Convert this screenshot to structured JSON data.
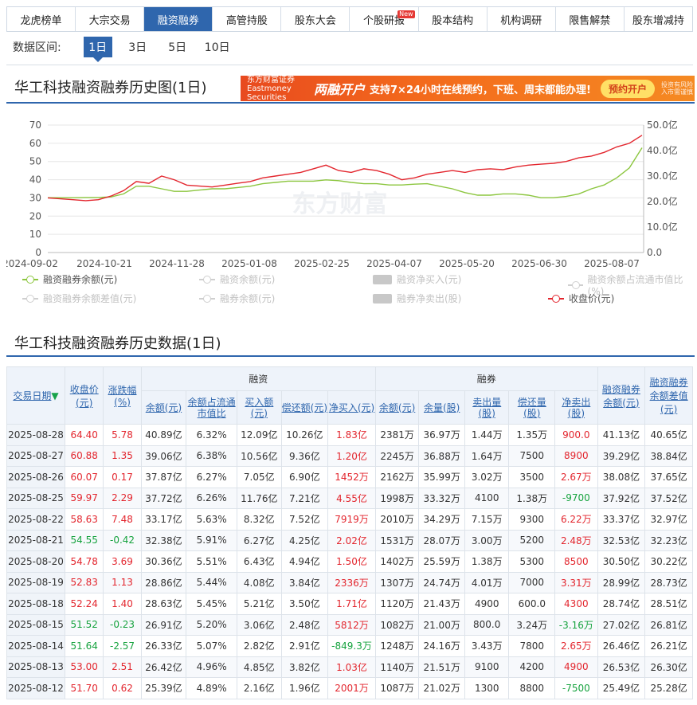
{
  "nav": {
    "tabs": [
      "龙虎榜单",
      "大宗交易",
      "融资融券",
      "高管持股",
      "股东大会",
      "个股研报",
      "股本结构",
      "机构调研",
      "限售解禁",
      "股东增减持"
    ],
    "active_index": 2,
    "badge_text": "New",
    "badge_index": 5
  },
  "range": {
    "label": "数据区间:",
    "options": [
      "1日",
      "3日",
      "5日",
      "10日"
    ],
    "active_index": 0
  },
  "chart_section_title": "华工科技融资融券历史图(1日)",
  "banner": {
    "logo": "东方财富证券 Eastmoney Securities",
    "headline": "两融开户",
    "text": "支持7×24小时在线预约，下班、周末都能办理!",
    "button": "预约开户",
    "tail": "投资有风险 入市需谨慎"
  },
  "watermark": "东方财富",
  "chart_data": {
    "type": "line",
    "x_ticks": [
      "2024-09-02",
      "2024-10-21",
      "2024-11-28",
      "2025-01-08",
      "2025-02-25",
      "2025-04-07",
      "2025-05-20",
      "2025-06-30",
      "2025-08-07"
    ],
    "y_left_ticks": [
      "70",
      "60",
      "50",
      "40",
      "30",
      "20",
      "10",
      "0"
    ],
    "y_left_range": [
      0,
      70
    ],
    "y_right_ticks": [
      "50.0亿",
      "40.0亿",
      "30.0亿",
      "20.0亿",
      "10.0亿",
      "0.0"
    ],
    "y_right_range": [
      0,
      50
    ],
    "grid": true,
    "series": [
      {
        "name": "收盘价(元)",
        "axis": "left",
        "color": "#e3262e",
        "values": [
          30,
          29.5,
          29,
          28.5,
          29,
          31,
          34,
          39,
          38,
          42,
          40,
          37,
          36.5,
          36,
          37,
          38,
          39,
          41,
          42,
          43,
          44,
          46,
          48,
          45,
          44,
          46,
          45,
          43,
          40,
          41,
          43,
          44,
          45,
          44,
          45.5,
          46,
          45.5,
          47,
          48,
          48.5,
          49,
          50,
          52,
          53,
          55,
          58,
          60,
          64.4
        ]
      },
      {
        "name": "融资融券余额(元)",
        "axis": "right",
        "color": "#8cc63f",
        "values": [
          21.5,
          21.5,
          21.5,
          21.6,
          21.6,
          21.8,
          23,
          26,
          26,
          25,
          24,
          24,
          24.5,
          25,
          25,
          25.5,
          26,
          27,
          27.5,
          28,
          28,
          28,
          28.5,
          28.2,
          27.5,
          27,
          27,
          26.5,
          26.5,
          26.8,
          27,
          26,
          25,
          23.5,
          22.5,
          22.5,
          23,
          23,
          22.5,
          21.5,
          21.5,
          22,
          23,
          25,
          26.5,
          29.3,
          33.2,
          41.1
        ]
      }
    ]
  },
  "legend": [
    {
      "label": "融资融券余额(元)",
      "kind": "line",
      "color": "#8cc63f",
      "active": true
    },
    {
      "label": "融资余额(元)",
      "kind": "line",
      "color": "#cfcfcf",
      "active": false
    },
    {
      "label": "融资净买入(元)",
      "kind": "bar",
      "color": "#c8c8c8",
      "active": false
    },
    {
      "label": "融资余额占流通市值比(%)",
      "kind": "line",
      "color": "#cfcfcf",
      "active": false
    },
    {
      "label": "融资融券余额差值(元)",
      "kind": "line",
      "color": "#cfcfcf",
      "active": false
    },
    {
      "label": "融券余额(元)",
      "kind": "line",
      "color": "#cfcfcf",
      "active": false
    },
    {
      "label": "融券净卖出(股)",
      "kind": "bar",
      "color": "#c8c8c8",
      "active": false
    },
    {
      "label": "收盘价(元)",
      "kind": "line",
      "color": "#e3262e",
      "active": true
    }
  ],
  "table_section_title": "华工科技融资融券历史数据(1日)",
  "table": {
    "group_headers": {
      "margin_buy": "融资",
      "short_sell": "融券"
    },
    "headers": {
      "date": "交易日期",
      "close": "收盘价(元)",
      "change": "涨跌幅(%)",
      "fin_balance": "余额(元)",
      "fin_ratio": "余额占流通市值比",
      "fin_buy": "买入额(元)",
      "fin_repay": "偿还额(元)",
      "fin_net": "净买入(元)",
      "sec_balance": "余额(元)",
      "sec_volume": "余量(股)",
      "sec_sell": "卖出量(股)",
      "sec_repay": "偿还量(股)",
      "sec_net": "净卖出(股)",
      "total": "融资融券余额(元)",
      "diff": "融资融券余额差值(元)"
    },
    "rows": [
      [
        "2025-08-28",
        "64.40",
        "5.78",
        "40.89亿",
        "6.32%",
        "12.09亿",
        "10.26亿",
        "1.83亿",
        "2381万",
        "36.97万",
        "1.44万",
        "1.35万",
        "900.0",
        "41.13亿",
        "40.65亿"
      ],
      [
        "2025-08-27",
        "60.88",
        "1.35",
        "39.06亿",
        "6.38%",
        "10.56亿",
        "9.36亿",
        "1.20亿",
        "2245万",
        "36.88万",
        "1.64万",
        "7500",
        "8900",
        "39.29亿",
        "38.84亿"
      ],
      [
        "2025-08-26",
        "60.07",
        "0.17",
        "37.87亿",
        "6.27%",
        "7.05亿",
        "6.90亿",
        "1452万",
        "2162万",
        "35.99万",
        "3.02万",
        "3500",
        "2.67万",
        "38.08亿",
        "37.65亿"
      ],
      [
        "2025-08-25",
        "59.97",
        "2.29",
        "37.72亿",
        "6.26%",
        "11.76亿",
        "7.21亿",
        "4.55亿",
        "1998万",
        "33.32万",
        "4100",
        "1.38万",
        "-9700",
        "37.92亿",
        "37.52亿"
      ],
      [
        "2025-08-22",
        "58.63",
        "7.48",
        "33.17亿",
        "5.63%",
        "8.32亿",
        "7.52亿",
        "7919万",
        "2010万",
        "34.29万",
        "7.15万",
        "9300",
        "6.22万",
        "33.37亿",
        "32.97亿"
      ],
      [
        "2025-08-21",
        "54.55",
        "-0.42",
        "32.38亿",
        "5.91%",
        "6.27亿",
        "4.25亿",
        "2.02亿",
        "1531万",
        "28.07万",
        "3.00万",
        "5200",
        "2.48万",
        "32.53亿",
        "32.23亿"
      ],
      [
        "2025-08-20",
        "54.78",
        "3.69",
        "30.36亿",
        "5.51%",
        "6.43亿",
        "4.94亿",
        "1.50亿",
        "1402万",
        "25.59万",
        "1.38万",
        "5300",
        "8500",
        "30.50亿",
        "30.22亿"
      ],
      [
        "2025-08-19",
        "52.83",
        "1.13",
        "28.86亿",
        "5.44%",
        "4.08亿",
        "3.84亿",
        "2336万",
        "1307万",
        "24.74万",
        "4.01万",
        "7000",
        "3.31万",
        "28.99亿",
        "28.73亿"
      ],
      [
        "2025-08-18",
        "52.24",
        "1.40",
        "28.63亿",
        "5.45%",
        "5.21亿",
        "3.50亿",
        "1.71亿",
        "1120万",
        "21.43万",
        "4900",
        "600.0",
        "4300",
        "28.74亿",
        "28.51亿"
      ],
      [
        "2025-08-15",
        "51.52",
        "-0.23",
        "26.91亿",
        "5.20%",
        "3.06亿",
        "2.48亿",
        "5812万",
        "1082万",
        "21.00万",
        "800.0",
        "3.24万",
        "-3.16万",
        "27.02亿",
        "26.81亿"
      ],
      [
        "2025-08-14",
        "51.64",
        "-2.57",
        "26.33亿",
        "5.07%",
        "2.82亿",
        "2.91亿",
        "-849.3万",
        "1248万",
        "24.16万",
        "3.43万",
        "7800",
        "2.65万",
        "26.46亿",
        "26.21亿"
      ],
      [
        "2025-08-13",
        "53.00",
        "2.51",
        "26.42亿",
        "4.96%",
        "4.85亿",
        "3.82亿",
        "1.03亿",
        "1140万",
        "21.51万",
        "9100",
        "4200",
        "4900",
        "26.53亿",
        "26.30亿"
      ],
      [
        "2025-08-12",
        "51.70",
        "0.62",
        "25.39亿",
        "4.89%",
        "2.16亿",
        "1.96亿",
        "2001万",
        "1087万",
        "21.02万",
        "1300",
        "8800",
        "-7500",
        "25.49亿",
        "25.28亿"
      ]
    ]
  }
}
